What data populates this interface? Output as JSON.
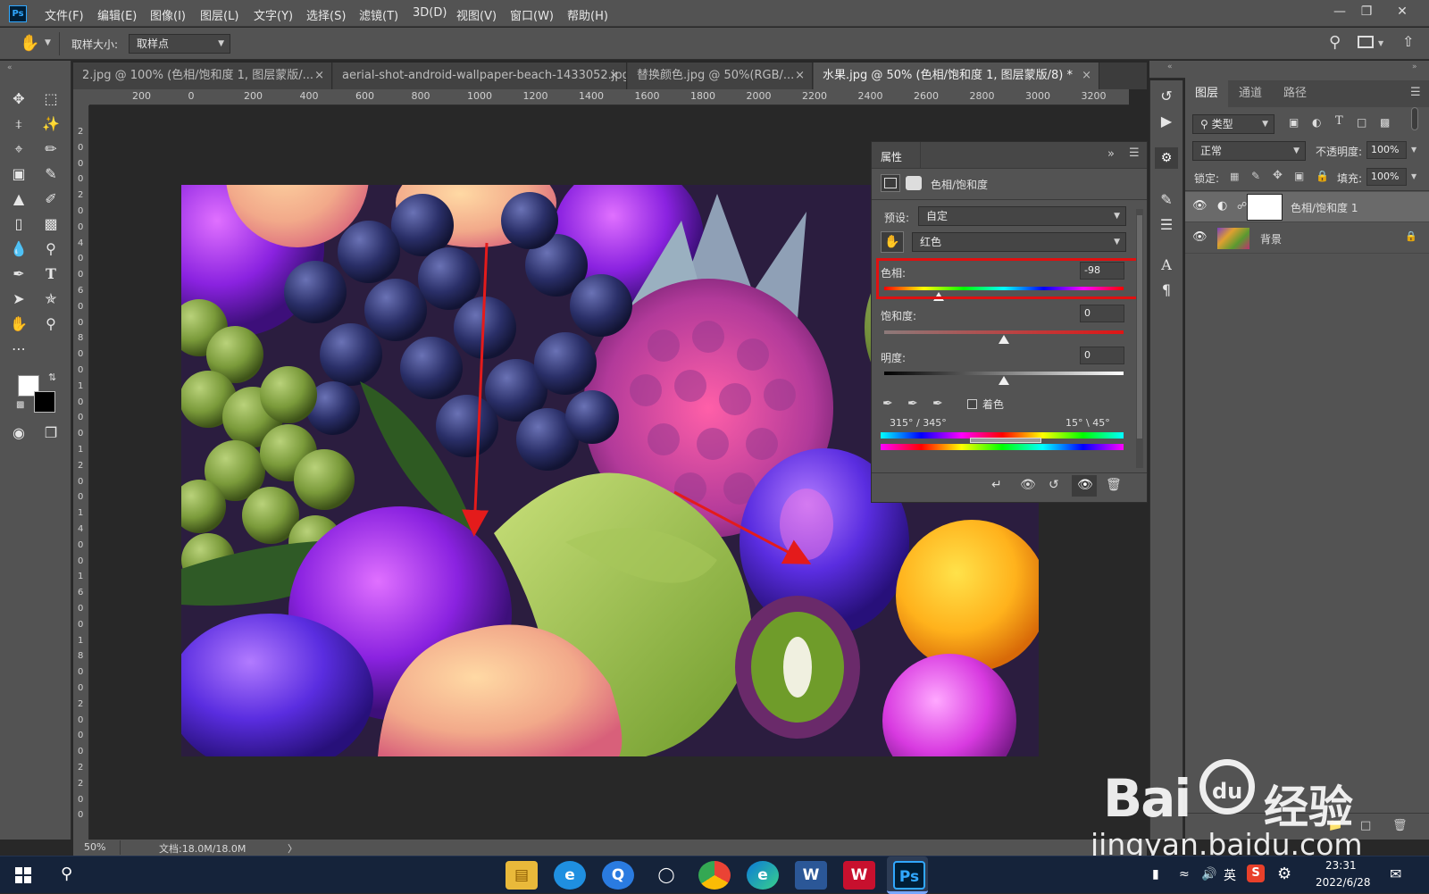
{
  "app": {
    "logo": "Ps"
  },
  "menu": [
    "文件(F)",
    "编辑(E)",
    "图像(I)",
    "图层(L)",
    "文字(Y)",
    "选择(S)",
    "滤镜(T)",
    "3D(D)",
    "视图(V)",
    "窗口(W)",
    "帮助(H)"
  ],
  "options_bar": {
    "sample_size_label": "取样大小:",
    "sample_size_value": "取样点"
  },
  "tabs": [
    {
      "label": "2.jpg @ 100% (色相/饱和度 1, 图层蒙版/...",
      "close": "×"
    },
    {
      "label": "aerial-shot-android-wallpaper-beach-1433052.jpg",
      "close": "×"
    },
    {
      "label": "替换颜色.jpg @ 50%(RGB/...",
      "close": "×"
    },
    {
      "label": "水果.jpg @ 50% (色相/饱和度 1, 图层蒙版/8) *",
      "close": "×"
    }
  ],
  "ruler_h": [
    "200",
    "0",
    "200",
    "400",
    "600",
    "800",
    "1000",
    "1200",
    "1400",
    "1600",
    "1800",
    "2000",
    "2200",
    "2400",
    "2600",
    "2800",
    "3000",
    "3200"
  ],
  "ruler_v": [
    "2",
    "0",
    "0",
    "0",
    "2",
    "0",
    "0",
    "4",
    "0",
    "0",
    "6",
    "0",
    "0",
    "8",
    "0",
    "0",
    "1",
    "0",
    "0",
    "0",
    "1",
    "2",
    "0",
    "0",
    "1",
    "4",
    "0",
    "0",
    "1",
    "6",
    "0",
    "0",
    "1",
    "8",
    "0",
    "0",
    "2",
    "0",
    "0",
    "0",
    "2",
    "2",
    "0",
    "0"
  ],
  "properties": {
    "title": "属性",
    "adjustment_name": "色相/饱和度",
    "preset_label": "预设:",
    "preset_value": "自定",
    "channel_value": "红色",
    "hue_label": "色相:",
    "hue_value": "-98",
    "hue_level": -98,
    "saturation_label": "饱和度:",
    "saturation_value": "0",
    "lightness_label": "明度:",
    "lightness_value": "0",
    "colorize_label": "着色",
    "range_left": "315° / 345°",
    "range_right": "15° \\ 45°"
  },
  "layers_panel": {
    "tabs": [
      "图层",
      "通道",
      "路径"
    ],
    "filter_value": "类型",
    "blend_mode": "正常",
    "opacity_label": "不透明度:",
    "opacity_value": "100%",
    "lock_label": "锁定:",
    "fill_label": "填充:",
    "fill_value": "100%",
    "layers": [
      {
        "name": "色相/饱和度 1"
      },
      {
        "name": "背景"
      }
    ]
  },
  "status": {
    "zoom": "50%",
    "doc_info": "文档:18.0M/18.0M",
    "arrow": "〉"
  },
  "taskbar": {
    "lang": "英",
    "time": "23:31",
    "date": "2022/6/28"
  },
  "watermark": {
    "brand": "Bai",
    "paw": "du",
    "suffix": "经验",
    "url": "jingyan.baidu.com"
  },
  "colors": {
    "highlight": "#e01010",
    "arrow": "#e41b1b",
    "panel": "#535353"
  }
}
